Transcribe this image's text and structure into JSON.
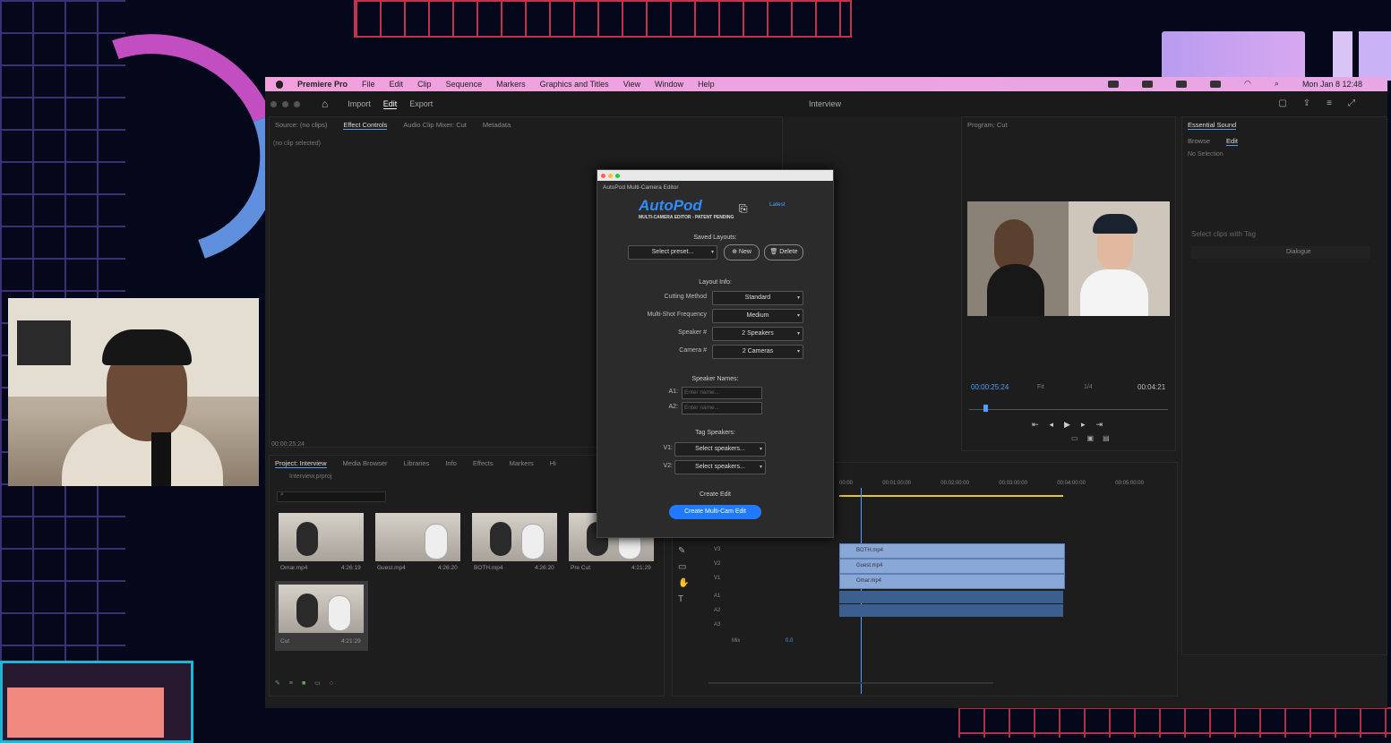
{
  "menubar": {
    "app": "Premiere Pro",
    "items": [
      "File",
      "Edit",
      "Clip",
      "Sequence",
      "Markers",
      "Graphics and Titles",
      "View",
      "Window",
      "Help"
    ],
    "clock": "Mon Jan 8  12:48"
  },
  "header": {
    "nav": [
      "Import",
      "Edit",
      "Export"
    ],
    "active": "Edit",
    "title": "Interview"
  },
  "source_panel": {
    "tabs": [
      "Source: (no clips)",
      "Effect Controls",
      "Audio Clip Mixer: Cut",
      "Metadata"
    ],
    "no_clip": "(no clip selected)",
    "timecode": "00:00:25:24"
  },
  "project_panel": {
    "tabs": [
      "Project: Interview",
      "Media Browser",
      "Libraries",
      "Info",
      "Effects",
      "Markers",
      "Hi"
    ],
    "file": "Interview.prproj",
    "clips": [
      {
        "name": "Omar.mp4",
        "dur": "4:26:19"
      },
      {
        "name": "Guest.mp4",
        "dur": "4:26:20"
      },
      {
        "name": "BOTH.mp4",
        "dur": "4:26:20"
      },
      {
        "name": "Pre Cut",
        "dur": "4:21:29"
      },
      {
        "name": "Cut",
        "dur": "4:21:29"
      }
    ]
  },
  "dialog": {
    "title": "AutoPod Multi-Camera Editor",
    "logo": "AutoPod",
    "tagline": "MULTI-CAMERA EDITOR - PATENT PENDING",
    "link": "Latest",
    "saved_layouts_label": "Saved Layouts:",
    "preset_placeholder": "Select preset...",
    "new_label": "New",
    "delete_label": "Delete",
    "layout_info_label": "Layout Info:",
    "fields": [
      {
        "label": "Cutting Method",
        "value": "Standard"
      },
      {
        "label": "Multi-Shot Frequency",
        "value": "Medium"
      },
      {
        "label": "Speaker #",
        "value": "2 Speakers"
      },
      {
        "label": "Camera #",
        "value": "2 Cameras"
      }
    ],
    "speaker_names_label": "Speaker Names:",
    "speakers": [
      {
        "label": "A1:",
        "placeholder": "Enter name..."
      },
      {
        "label": "A2:",
        "placeholder": "Enter name..."
      }
    ],
    "tag_speakers_label": "Tag Speakers:",
    "tags": [
      {
        "label": "V1:",
        "value": "Select speakers..."
      },
      {
        "label": "V2:",
        "value": "Select speakers..."
      }
    ],
    "create_edit_label": "Create Edit",
    "create_button": "Create Multi-Cam Edit"
  },
  "program": {
    "tab": "Program: Cut",
    "timecode": "00:00:25:24",
    "fit": "Fit",
    "quality": "1/4",
    "duration": "00:04:21"
  },
  "essential_sound": {
    "title": "Essential Sound",
    "tabs": [
      "Browse",
      "Edit"
    ],
    "no_selection": "No Selection",
    "hint": "Select clips with Tag",
    "dialogue": "Dialogue"
  },
  "timeline": {
    "ruler": [
      "00:00",
      "00:01:00:00",
      "00:02:00:00",
      "00:03:00:00",
      "00:04:00:00",
      "00:05:00:00"
    ],
    "video_tracks": [
      "V3",
      "V2",
      "V1"
    ],
    "audio_tracks": [
      "A1",
      "A2",
      "A3"
    ],
    "clips": [
      "BOTH.mp4",
      "Guest.mp4",
      "Omar.mp4"
    ],
    "mix_label": "Mix",
    "mix_value": "0.0"
  },
  "colors": {
    "accent": "#1f7aff",
    "menubar": "#f2a0dc",
    "clip": "#89a8d8"
  }
}
